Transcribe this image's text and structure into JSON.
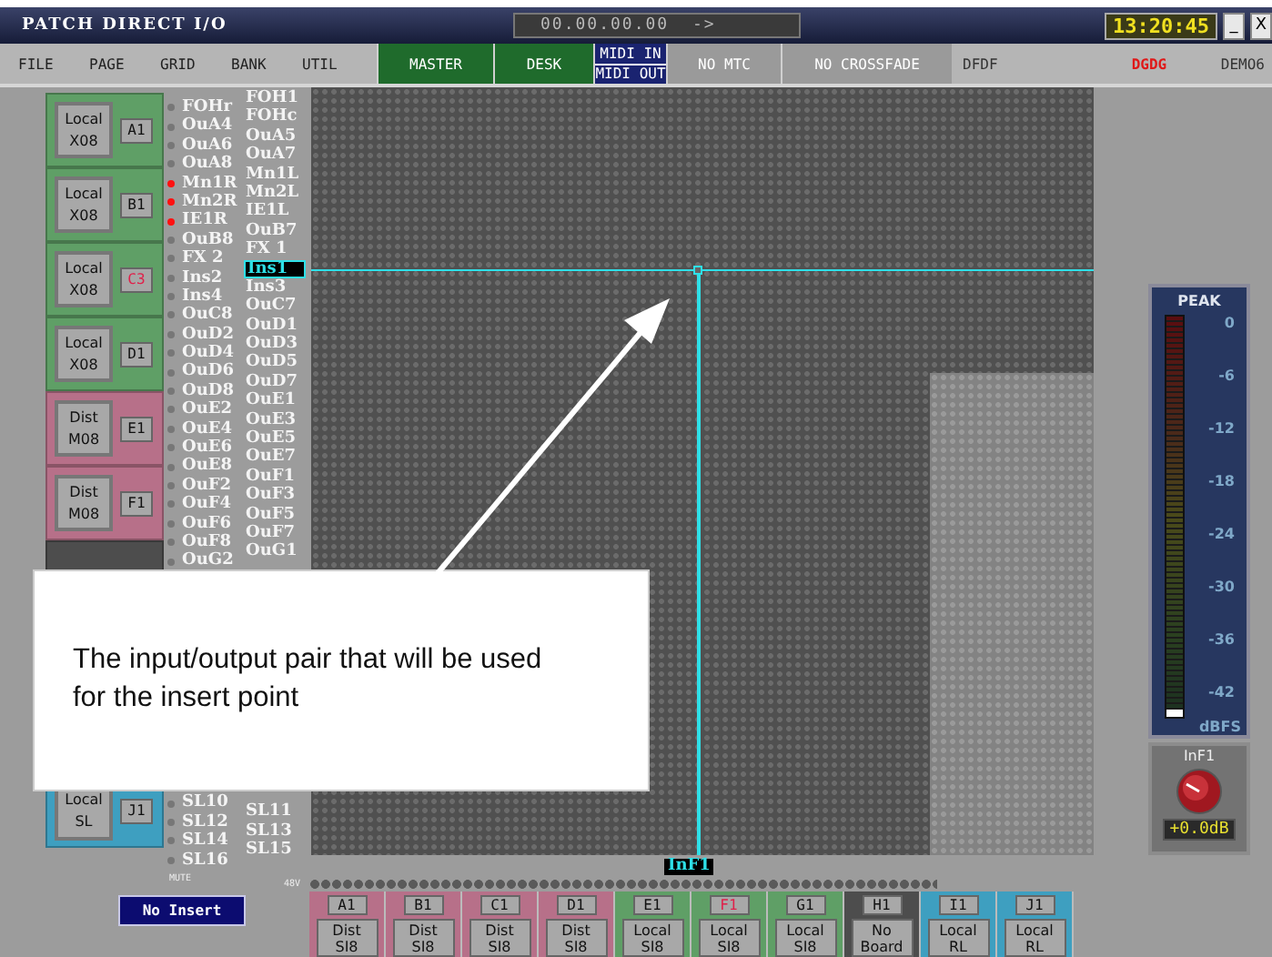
{
  "window": {
    "title": "PATCH DIRECT I/O",
    "timecode": "00.00.00.00  ->",
    "clock": "13:20:45",
    "controls": [
      "_",
      "X"
    ]
  },
  "menu": [
    {
      "label": "FILE"
    },
    {
      "label": "PAGE"
    },
    {
      "label": "GRID"
    },
    {
      "label": "BANK"
    },
    {
      "label": "UTIL"
    }
  ],
  "status": [
    {
      "lines": [
        "MASTER"
      ],
      "color": "#1f6b2c",
      "alert": false
    },
    {
      "lines": [
        "DESK"
      ],
      "color": "#1f6b2c",
      "alert": false
    },
    {
      "lines": [
        "MIDI IN",
        "MIDI OUT"
      ],
      "color": "#1a2370",
      "alert": false
    },
    {
      "lines": [
        "NO MTC"
      ],
      "color": "#9a9a9a",
      "alert": false
    },
    {
      "lines": [
        "NO CROSSFADE"
      ],
      "color": "#9a9a9a",
      "alert": false
    },
    {
      "lines": [
        "DFDF"
      ],
      "color": "#b5b5b5",
      "alert": false
    },
    {
      "lines": [
        "DGDG"
      ],
      "color": "#b5b5b5",
      "alert": true
    },
    {
      "lines": [
        "DEMO6"
      ],
      "color": "#b5b5b5",
      "alert": false
    }
  ],
  "left_boards": [
    {
      "kind": "board",
      "slot": "A1",
      "type": "Local",
      "model": "X08",
      "color": "#5f9f66",
      "alert": false
    },
    {
      "kind": "board",
      "slot": "B1",
      "type": "Local",
      "model": "X08",
      "color": "#5f9f66",
      "alert": false
    },
    {
      "kind": "board",
      "slot": "C3",
      "type": "Local",
      "model": "X08",
      "color": "#5f9f66",
      "alert": true
    },
    {
      "kind": "board",
      "slot": "D1",
      "type": "Local",
      "model": "X08",
      "color": "#5f9f66",
      "alert": false
    },
    {
      "kind": "board",
      "slot": "E1",
      "type": "Dist",
      "model": "M08",
      "color": "#b77089",
      "alert": false
    },
    {
      "kind": "board",
      "slot": "F1",
      "type": "Dist",
      "model": "M08",
      "color": "#b77089",
      "alert": false
    },
    {
      "kind": "blank",
      "color": "#4d4d4d"
    },
    {
      "kind": "board",
      "slot": "J1",
      "type": "Local",
      "model": "SL",
      "color": "#3e9fc0",
      "alert": false
    }
  ],
  "row_labels": {
    "upper": {
      "column_1": [
        {
          "text": "FOHr",
          "flagged": false
        },
        {
          "text": "OuA4",
          "flagged": false
        },
        {
          "text": "OuA6",
          "flagged": false
        },
        {
          "text": "OuA8",
          "flagged": false
        },
        {
          "text": "Mn1R",
          "flagged": true
        },
        {
          "text": "Mn2R",
          "flagged": true
        },
        {
          "text": "IE1R",
          "flagged": true
        },
        {
          "text": "OuB8",
          "flagged": false
        },
        {
          "text": "FX 2",
          "flagged": false
        },
        {
          "text": "Ins2",
          "flagged": false
        },
        {
          "text": "Ins4",
          "flagged": false
        },
        {
          "text": "OuC8",
          "flagged": false
        },
        {
          "text": "OuD2",
          "flagged": false
        },
        {
          "text": "OuD4",
          "flagged": false
        },
        {
          "text": "OuD6",
          "flagged": false
        },
        {
          "text": "OuD8",
          "flagged": false
        },
        {
          "text": "OuE2",
          "flagged": false
        },
        {
          "text": "OuE4",
          "flagged": false
        },
        {
          "text": "OuE6",
          "flagged": false
        },
        {
          "text": "OuE8",
          "flagged": false
        },
        {
          "text": "OuF2",
          "flagged": false
        },
        {
          "text": "OuF4",
          "flagged": false
        },
        {
          "text": "OuF6",
          "flagged": false
        },
        {
          "text": "OuF8",
          "flagged": false
        },
        {
          "text": "OuG2",
          "flagged": false
        }
      ],
      "column_2": [
        {
          "text": "FOH1",
          "selected": false
        },
        {
          "text": "FOHc",
          "selected": false
        },
        {
          "text": "OuA5",
          "selected": false
        },
        {
          "text": "OuA7",
          "selected": false
        },
        {
          "text": "Mn1L",
          "selected": false
        },
        {
          "text": "Mn2L",
          "selected": false
        },
        {
          "text": "IE1L",
          "selected": false
        },
        {
          "text": "OuB7",
          "selected": false
        },
        {
          "text": "FX 1",
          "selected": false
        },
        {
          "text": "Ins1",
          "selected": true
        },
        {
          "text": "Ins3",
          "selected": false
        },
        {
          "text": "OuC7",
          "selected": false
        },
        {
          "text": "OuD1",
          "selected": false
        },
        {
          "text": "OuD3",
          "selected": false
        },
        {
          "text": "OuD5",
          "selected": false
        },
        {
          "text": "OuD7",
          "selected": false
        },
        {
          "text": "OuE1",
          "selected": false
        },
        {
          "text": "OuE3",
          "selected": false
        },
        {
          "text": "OuE5",
          "selected": false
        },
        {
          "text": "OuE7",
          "selected": false
        },
        {
          "text": "OuF1",
          "selected": false
        },
        {
          "text": "OuF3",
          "selected": false
        },
        {
          "text": "OuF5",
          "selected": false
        },
        {
          "text": "OuF7",
          "selected": false
        },
        {
          "text": "OuG1",
          "selected": false
        }
      ]
    },
    "lower": {
      "column_1": [
        {
          "text": "SL10",
          "flagged": false
        },
        {
          "text": "SL12",
          "flagged": false
        },
        {
          "text": "SL14",
          "flagged": false
        },
        {
          "text": "SL16",
          "flagged": false
        }
      ],
      "column_2": [
        {
          "text": "SL11",
          "selected": false
        },
        {
          "text": "SL13",
          "selected": false
        },
        {
          "text": "SL15",
          "selected": false
        }
      ]
    }
  },
  "column_marker": "InF1",
  "meter": {
    "title": "PEAK",
    "scale": [
      "0",
      "-6",
      "-12",
      "-18",
      "-24",
      "-30",
      "-36",
      "-42"
    ],
    "unit": "dBFS",
    "level": 0.02
  },
  "knob": {
    "label": "InF1",
    "value": "+0.0dB"
  },
  "mute_label": "MUTE",
  "insert_button": "No Insert",
  "phantom_label": "48V",
  "bottom_boards": [
    {
      "slot": "A1",
      "type": "Dist",
      "model": "SI8",
      "color": "#b77089",
      "alert": false
    },
    {
      "slot": "B1",
      "type": "Dist",
      "model": "SI8",
      "color": "#b77089",
      "alert": false
    },
    {
      "slot": "C1",
      "type": "Dist",
      "model": "SI8",
      "color": "#b77089",
      "alert": false
    },
    {
      "slot": "D1",
      "type": "Dist",
      "model": "SI8",
      "color": "#b77089",
      "alert": false
    },
    {
      "slot": "E1",
      "type": "Local",
      "model": "SI8",
      "color": "#5f9f66",
      "alert": false
    },
    {
      "slot": "F1",
      "type": "Local",
      "model": "SI8",
      "color": "#5f9f66",
      "alert": true
    },
    {
      "slot": "G1",
      "type": "Local",
      "model": "SI8",
      "color": "#5f9f66",
      "alert": false
    },
    {
      "slot": "H1",
      "type": "No",
      "model": "Board",
      "color": "#4d4d4d",
      "alert": false
    },
    {
      "slot": "I1",
      "type": "Local",
      "model": "RL",
      "color": "#3e9fc0",
      "alert": false
    },
    {
      "slot": "J1",
      "type": "Local",
      "model": "RL",
      "color": "#3e9fc0",
      "alert": false
    }
  ],
  "callout": "The input/output pair that will be used for the insert point"
}
